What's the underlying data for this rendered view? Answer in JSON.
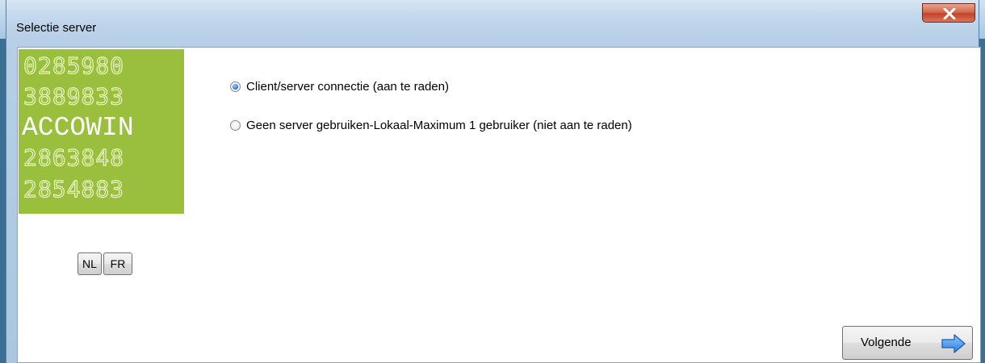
{
  "window": {
    "title": "Selectie server"
  },
  "logo": {
    "brand_text": "ACCOWIN",
    "digit_rows": [
      "0285980",
      "3889833",
      "2863848",
      "2854883"
    ]
  },
  "options": [
    {
      "label": "Client/server connectie (aan te raden)",
      "checked": true
    },
    {
      "label": "Geen server gebruiken-Lokaal-Maximum 1 gebruiker (niet aan te raden)",
      "checked": false
    }
  ],
  "language_buttons": [
    "NL",
    "FR"
  ],
  "footer": {
    "next_label": "Volgende"
  },
  "colors": {
    "logo_green": "#9abf3d",
    "arrow_blue": "#3a8ee6",
    "close_red": "#c2442a"
  }
}
